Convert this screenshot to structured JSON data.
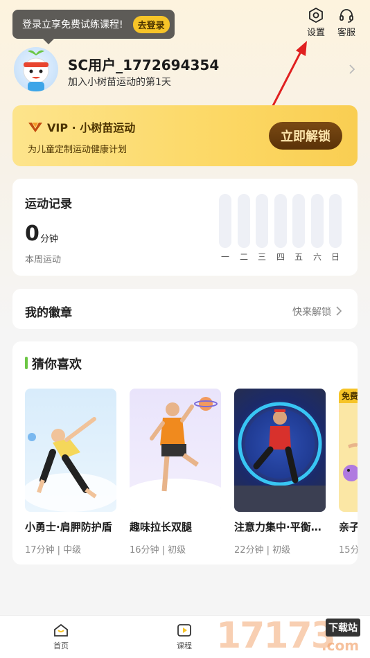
{
  "tooltip": {
    "text": "登录立享免费试练课程!",
    "button": "去登录"
  },
  "top_actions": {
    "settings": "设置",
    "service": "客服"
  },
  "user": {
    "name": "SC用户_1772694354",
    "subtitle": "加入小树苗运动的第1天"
  },
  "vip": {
    "title": "VIP · 小树苗运动",
    "subtitle": "为儿童定制运动健康计划",
    "button": "立即解锁"
  },
  "record": {
    "title": "运动记录",
    "minutes": "0",
    "unit": "分钟",
    "subtitle": "本周运动",
    "days": [
      "一",
      "二",
      "三",
      "四",
      "五",
      "六",
      "日"
    ]
  },
  "badges": {
    "title": "我的徽章",
    "link": "快来解锁"
  },
  "recommend": {
    "title": "猜你喜欢",
    "courses": [
      {
        "name": "小勇士·肩胛防护盾",
        "meta": "17分钟 | 中级"
      },
      {
        "name": "趣味拉长双腿",
        "meta": "16分钟 | 初级"
      },
      {
        "name": "注意力集中·平衡…",
        "meta": "22分钟 | 初级"
      },
      {
        "name": "亲子",
        "meta": "15分",
        "tag": "免费"
      }
    ]
  },
  "nav": {
    "home": "首页",
    "course": "课程"
  },
  "watermark": {
    "digits": "17173",
    "site": "下载站",
    "domain": ".com"
  },
  "colors": {
    "accent": "#f6c428",
    "vip_btn": "#6b3e0e",
    "green": "#6cc644",
    "arrow": "#e02020"
  }
}
